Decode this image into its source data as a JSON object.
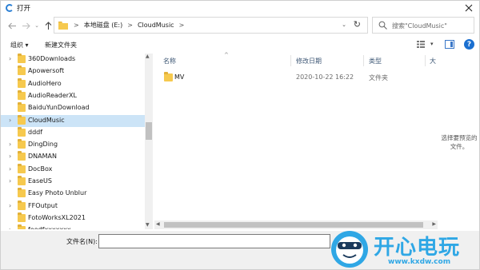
{
  "window": {
    "title": "打开"
  },
  "address": {
    "crumbs": [
      "本地磁盘 (E:)",
      "CloudMusic"
    ],
    "separator": ">"
  },
  "search": {
    "placeholder": "搜索\"CloudMusic\""
  },
  "toolbar": {
    "organize_label": "组织 ▾",
    "new_folder_label": "新建文件夹"
  },
  "tree": {
    "items": [
      {
        "label": "360Downloads",
        "expandable": true,
        "selected": false
      },
      {
        "label": "Apowersoft",
        "expandable": false,
        "selected": false
      },
      {
        "label": "AudioHero",
        "expandable": false,
        "selected": false
      },
      {
        "label": "AudioReaderXL",
        "expandable": false,
        "selected": false
      },
      {
        "label": "BaiduYunDownload",
        "expandable": false,
        "selected": false
      },
      {
        "label": "CloudMusic",
        "expandable": true,
        "selected": true
      },
      {
        "label": "dddf",
        "expandable": false,
        "selected": false
      },
      {
        "label": "DingDing",
        "expandable": true,
        "selected": false
      },
      {
        "label": "DNAMAN",
        "expandable": true,
        "selected": false
      },
      {
        "label": "DocBox",
        "expandable": true,
        "selected": false
      },
      {
        "label": "EaseUS",
        "expandable": true,
        "selected": false
      },
      {
        "label": "Easy Photo Unblur",
        "expandable": false,
        "selected": false
      },
      {
        "label": "FFOutput",
        "expandable": true,
        "selected": false
      },
      {
        "label": "FotoWorksXL2021",
        "expandable": false,
        "selected": false
      },
      {
        "label": "foodfxxxxxxx",
        "expandable": true,
        "selected": false
      }
    ]
  },
  "list": {
    "headers": {
      "name": "名称",
      "modified": "修改日期",
      "type": "类型",
      "size": "大"
    },
    "rows": [
      {
        "name": "MV",
        "modified": "2020-10-22 16:22",
        "type": "文件夹"
      }
    ]
  },
  "preview": {
    "message_line1": "选择要预览的",
    "message_line2": "文件。"
  },
  "footer": {
    "filename_label": "文件名(N):",
    "filename_value": ""
  },
  "watermark": {
    "name": "开心电玩",
    "url": "www.kxdw.com"
  },
  "colors": {
    "selection": "#cce4f7",
    "folder": "#f6c94e",
    "accent": "#2fa7e5"
  }
}
